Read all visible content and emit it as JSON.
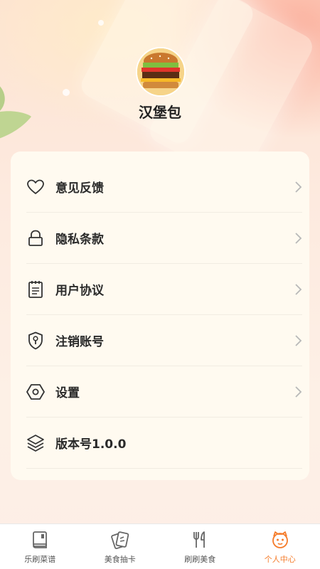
{
  "profile": {
    "nickname": "汉堡包",
    "avatar_icon": "burger-avatar"
  },
  "menu": {
    "items": [
      {
        "label": "意见反馈",
        "icon": "heart-icon"
      },
      {
        "label": "隐私条款",
        "icon": "lock-icon"
      },
      {
        "label": "用户协议",
        "icon": "document-icon"
      },
      {
        "label": "注销账号",
        "icon": "shield-key-icon"
      },
      {
        "label": "设置",
        "icon": "hexagon-settings-icon"
      },
      {
        "label": "版本号1.0.0",
        "icon": "layers-icon"
      }
    ]
  },
  "tabbar": {
    "tabs": [
      {
        "label": "乐刷菜谱",
        "icon": "book-icon",
        "active": false
      },
      {
        "label": "美食抽卡",
        "icon": "cards-icon",
        "active": false
      },
      {
        "label": "刷刷美食",
        "icon": "fork-knife-icon",
        "active": false
      },
      {
        "label": "个人中心",
        "icon": "face-icon",
        "active": true
      }
    ],
    "active_color": "#f57c2b",
    "inactive_color": "#555555"
  }
}
